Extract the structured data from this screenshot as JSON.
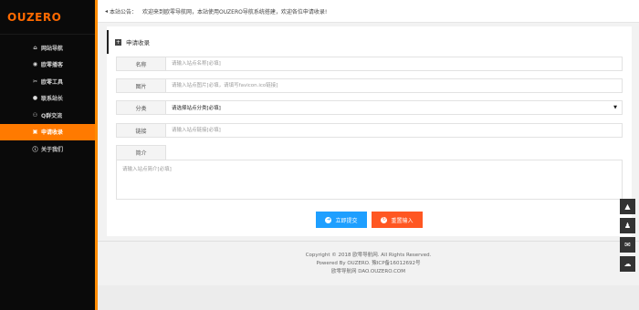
{
  "brand": {
    "logo_text": "OUZERO",
    "accent": "#ff7a00",
    "active_bg": "#ff7a00"
  },
  "sidebar": {
    "items": [
      {
        "label": "网站导航",
        "icon": "home-icon",
        "active": false
      },
      {
        "label": "欧零播客",
        "icon": "podcast-icon",
        "active": false
      },
      {
        "label": "欧零工具",
        "icon": "tools-icon",
        "active": false
      },
      {
        "label": "联系站长",
        "icon": "bell-icon",
        "active": false
      },
      {
        "label": "Q群交流",
        "icon": "group-chat-icon",
        "active": false
      },
      {
        "label": "申请收录",
        "icon": "submit-site-icon",
        "active": true
      },
      {
        "label": "关于我们",
        "icon": "info-icon",
        "active": false
      }
    ]
  },
  "topbar": {
    "notice_label": "本站公告：",
    "notice_text": "欢迎来到欧零导航网，本站使用OUZERO导航系统搭建，欢迎各位申请收录!"
  },
  "form": {
    "title": "申请收录",
    "name_label": "名称",
    "name_placeholder": "请输入站点名称[必填]",
    "image_label": "图片",
    "image_placeholder": "请输入站点图片[必填，请填写favicon.ico链接]",
    "category_label": "分类",
    "category_value": "请选择站点分类[必填]",
    "link_label": "链接",
    "link_placeholder": "请输入站点链接[必填]",
    "desc_label": "简介",
    "desc_placeholder": "请输入站点简介[必填]",
    "submit_label": "立即提交",
    "reset_label": "重置输入"
  },
  "footer": {
    "copyright": "Copyright © 2018 欧零导航网. All Rights Reserved.",
    "powered": "Powered By OUZERO. 豫ICP备16012692号",
    "domain": "欧零导航网 DAO.OUZERO.COM"
  },
  "side_tools": [
    "qq-icon",
    "penguin-icon",
    "mail-icon",
    "wechat-icon"
  ]
}
